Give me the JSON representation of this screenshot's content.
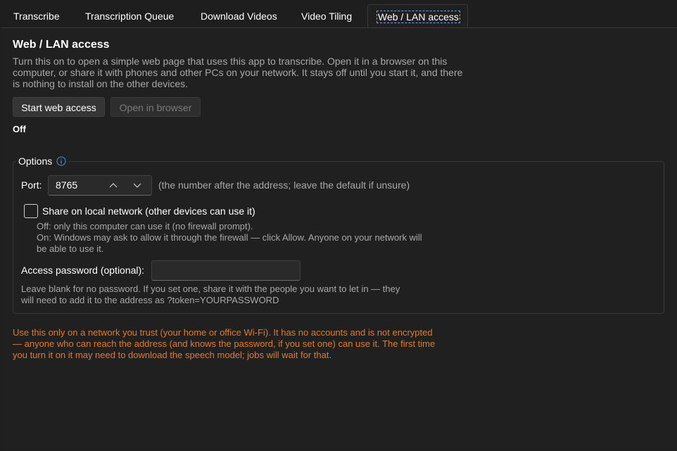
{
  "tabs": [
    {
      "label": "Transcribe",
      "active": false
    },
    {
      "label": "Transcription Queue",
      "active": false
    },
    {
      "label": "Download Videos",
      "active": false
    },
    {
      "label": "Video Tiling",
      "active": false
    },
    {
      "label": "Web / LAN access",
      "active": true
    }
  ],
  "section": {
    "title": "Web / LAN access",
    "description": "Turn this on to open a simple web page that uses this app to transcribe. Open it in a browser on this computer, or share it with phones and other PCs on your network. It stays off until you start it, and there is nothing to install on the other devices."
  },
  "buttons": {
    "start": "Start web access",
    "open": "Open in browser"
  },
  "status": "Off",
  "options": {
    "legend": "Options",
    "port_label": "Port:",
    "port_value": "8765",
    "port_hint": "(the number after the address; leave the default if unsure)",
    "share_label": "Share on local network (other devices can use it)",
    "share_checked": false,
    "share_note_off": "Off: only this computer can use it (no firewall prompt).",
    "share_note_on": "On: Windows may ask to allow it through the firewall — click Allow. Anyone on your network will be able to use it.",
    "password_label": "Access password (optional):",
    "password_value": "",
    "password_note": "Leave blank for no password. If you set one, share it with the people you want to let in — they will need to add it to the address as  ?token=YOURPASSWORD"
  },
  "warning": "Use this only on a network you trust (your home or office Wi-Fi). It has no accounts and is not encrypted — anyone who can reach the address (and knows the password, if you set one) can use it. The first time you turn it on it may need to download the speech model; jobs will wait for that.",
  "colors": {
    "warning": "#e07b2a",
    "info_icon": "#4a8fe7",
    "focus": "#6aa0ff"
  }
}
